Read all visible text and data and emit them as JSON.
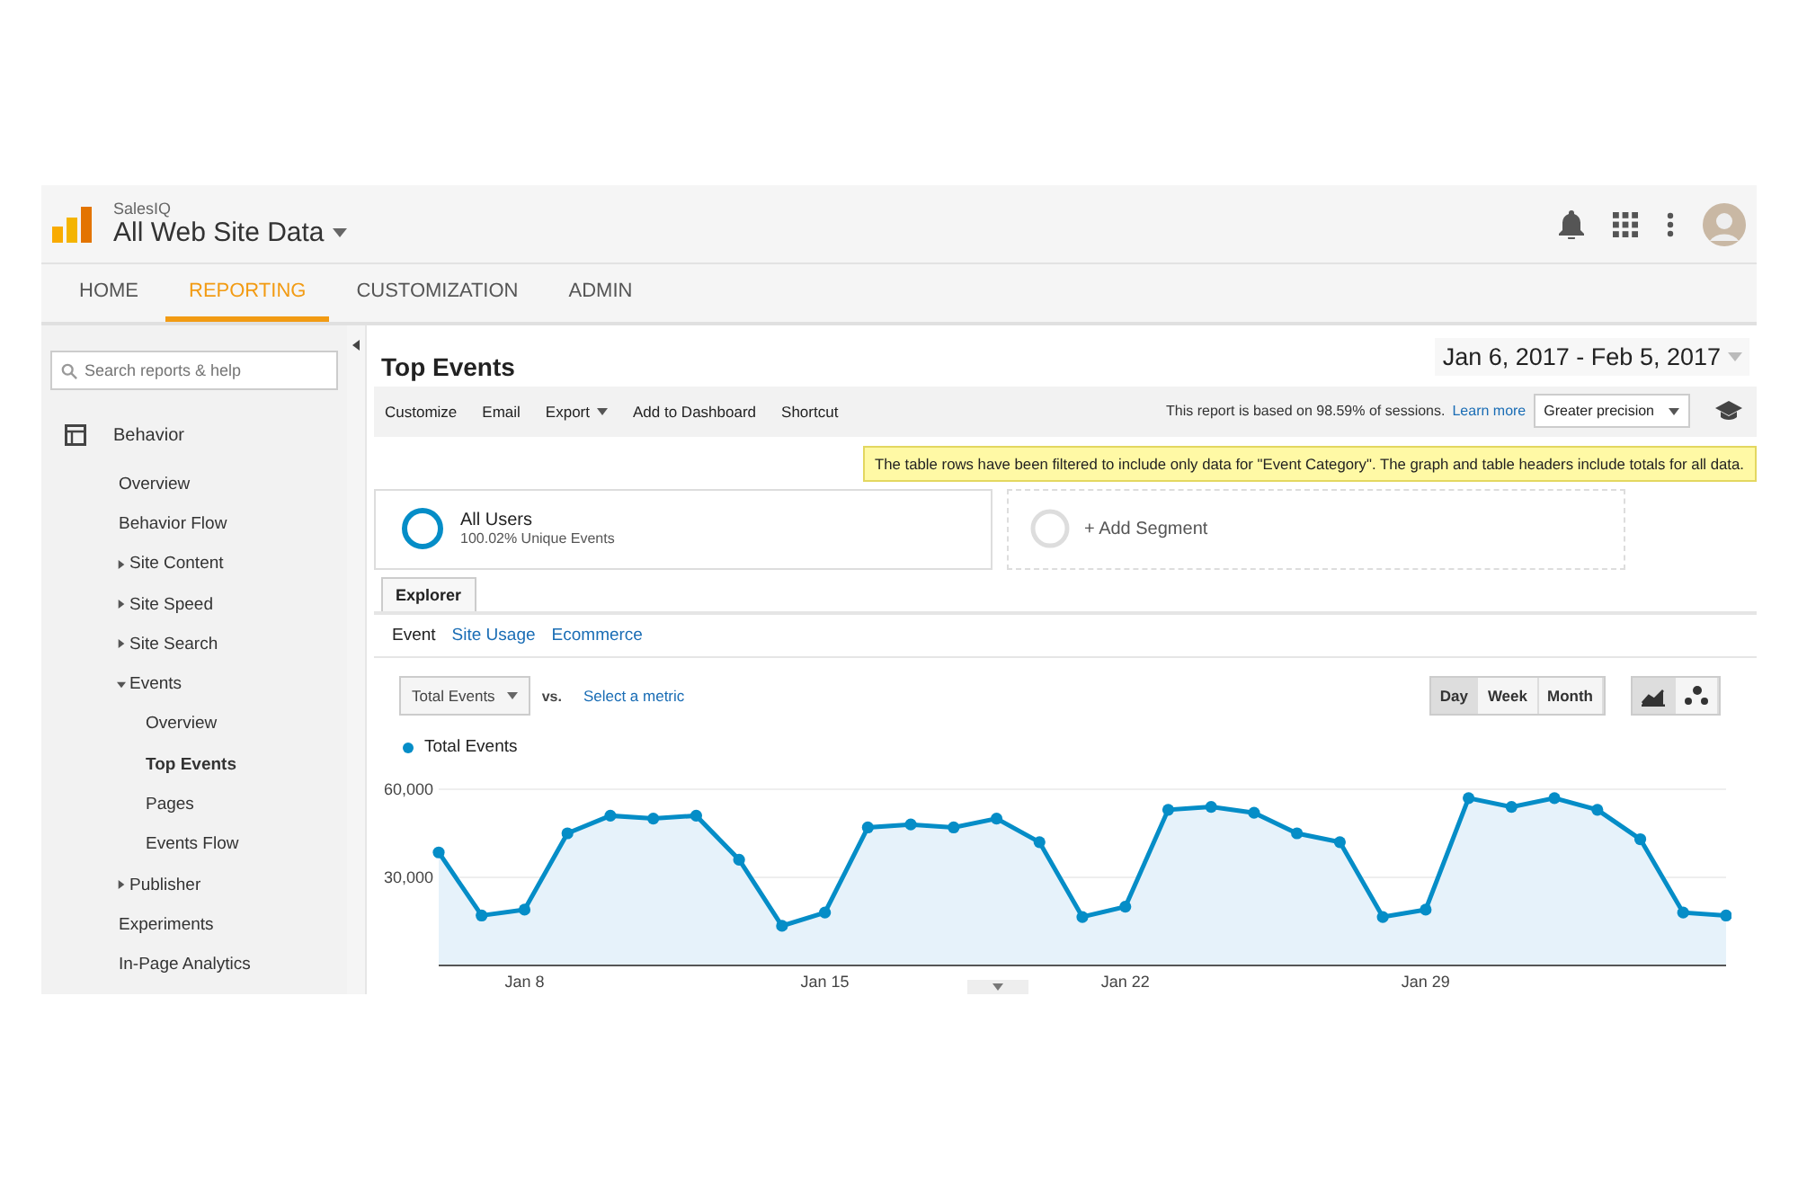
{
  "header": {
    "account": "SalesIQ",
    "property": "All Web Site Data"
  },
  "nav_tabs": [
    {
      "label": "HOME",
      "selected": false
    },
    {
      "label": "REPORTING",
      "selected": true
    },
    {
      "label": "CUSTOMIZATION",
      "selected": false
    },
    {
      "label": "ADMIN",
      "selected": false
    }
  ],
  "sidebar": {
    "search": {
      "placeholder": "Search reports & help"
    },
    "section": "Behavior",
    "items": [
      {
        "label": "Overview",
        "kind": "link",
        "selected": false
      },
      {
        "label": "Behavior Flow",
        "kind": "link",
        "selected": false
      },
      {
        "label": "Site Content",
        "kind": "folder",
        "expanded": false,
        "selected": false
      },
      {
        "label": "Site Speed",
        "kind": "folder",
        "expanded": false,
        "selected": false
      },
      {
        "label": "Site Search",
        "kind": "folder",
        "expanded": false,
        "selected": false
      },
      {
        "label": "Events",
        "kind": "folder",
        "expanded": true,
        "selected": false,
        "children": [
          {
            "label": "Overview",
            "selected": false
          },
          {
            "label": "Top Events",
            "selected": true
          },
          {
            "label": "Pages",
            "selected": false
          },
          {
            "label": "Events Flow",
            "selected": false
          }
        ]
      },
      {
        "label": "Publisher",
        "kind": "folder",
        "expanded": false,
        "selected": false
      },
      {
        "label": "Experiments",
        "kind": "link",
        "selected": false
      },
      {
        "label": "In-Page Analytics",
        "kind": "link",
        "selected": false
      }
    ]
  },
  "report": {
    "title": "Top Events",
    "date_range": "Jan 6, 2017 - Feb 5, 2017",
    "toolbar": [
      {
        "label": "Customize",
        "kind": "plain"
      },
      {
        "label": "Email",
        "kind": "plain"
      },
      {
        "label": "Export",
        "kind": "menu"
      },
      {
        "label": "Add to Dashboard",
        "kind": "plain"
      },
      {
        "label": "Shortcut",
        "kind": "plain"
      }
    ],
    "sampling": {
      "text": "This report is based on 98.59% of sessions.",
      "link": "Learn more",
      "precision": "Greater precision"
    },
    "notice": "The table rows have been filtered to include only data for \"Event Category\". The graph and table headers include totals for all data.",
    "segments": [
      {
        "name": "All Users",
        "detail": "100.02% Unique Events",
        "kind": "active"
      },
      {
        "name": "+ Add Segment",
        "kind": "add"
      }
    ],
    "explorer_tab": "Explorer",
    "subtabs": [
      {
        "label": "Event",
        "selected": true
      },
      {
        "label": "Site Usage",
        "selected": false
      },
      {
        "label": "Ecommerce",
        "selected": false
      }
    ],
    "metric": "Total Events",
    "vs": "vs.",
    "second_metric": "Select a metric",
    "periods": [
      {
        "label": "Day",
        "selected": true
      },
      {
        "label": "Week",
        "selected": false
      },
      {
        "label": "Month",
        "selected": false
      }
    ],
    "chart_types": [
      {
        "kind": "line",
        "selected": true
      },
      {
        "kind": "motion",
        "selected": false
      }
    ],
    "chart_data": {
      "type": "area",
      "categories": [
        null,
        null,
        "Jan 8",
        null,
        null,
        null,
        null,
        null,
        null,
        "Jan 15",
        null,
        null,
        null,
        null,
        null,
        null,
        "Jan 22",
        null,
        null,
        null,
        null,
        null,
        null,
        "Jan 29",
        null,
        null,
        null,
        null,
        null,
        null,
        null
      ],
      "series": [
        {
          "name": "Total Events",
          "color": "#058dc7",
          "values": [
            38500,
            17000,
            19000,
            45000,
            51000,
            50000,
            51000,
            36000,
            13500,
            18000,
            47000,
            48000,
            47000,
            50000,
            42000,
            16500,
            20000,
            53000,
            54000,
            52000,
            45000,
            42000,
            16500,
            19000,
            57000,
            54000,
            57000,
            53000,
            43000,
            18000,
            17000
          ]
        }
      ],
      "ylim": [
        0,
        60000
      ],
      "yticks": [
        {
          "value": 30000,
          "label": "30,000"
        },
        {
          "value": 60000,
          "label": "60,000"
        }
      ]
    }
  }
}
